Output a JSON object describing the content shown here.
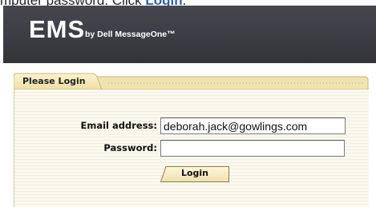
{
  "caption": {
    "prefix": "mputer password. Click ",
    "link": "Login",
    "suffix": "."
  },
  "header": {
    "brand": "EMS",
    "tagline": "by Dell MessageOne™"
  },
  "panel": {
    "title": "Please Login"
  },
  "form": {
    "email_label": "Email address:",
    "email_value": "deborah.jack@gowlings.com",
    "password_label": "Password:",
    "password_value": "",
    "login_label": "Login"
  },
  "colors": {
    "banner": "#3c3c44",
    "tab": "#f4e8b6",
    "link": "#2a62b3"
  }
}
